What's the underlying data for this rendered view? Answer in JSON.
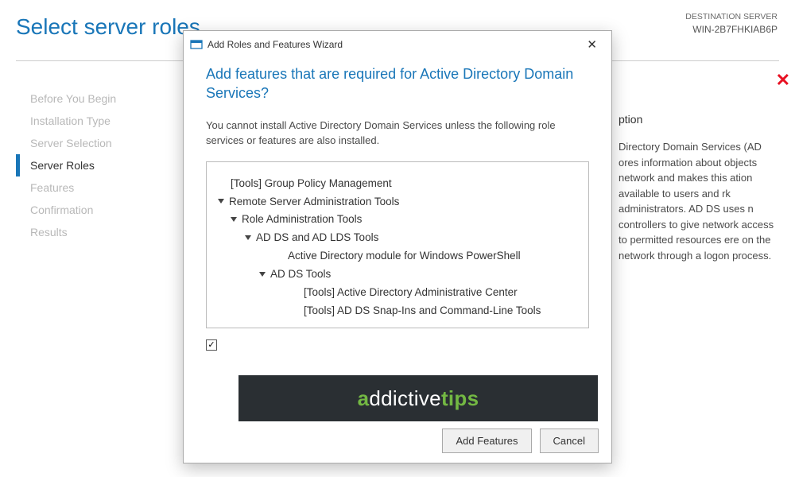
{
  "page_title": "Select server roles",
  "destination": {
    "label": "DESTINATION SERVER",
    "name": "WIN-2B7FHKIAB6P"
  },
  "sidebar": {
    "items": [
      {
        "label": "Before You Begin",
        "active": false
      },
      {
        "label": "Installation Type",
        "active": false
      },
      {
        "label": "Server Selection",
        "active": false
      },
      {
        "label": "Server Roles",
        "active": true
      },
      {
        "label": "Features",
        "active": false
      },
      {
        "label": "Confirmation",
        "active": false
      },
      {
        "label": "Results",
        "active": false
      }
    ]
  },
  "description": {
    "title_visible": "ption",
    "body_visible": "Directory Domain Services (AD ores information about objects network and makes this ation available to users and rk administrators. AD DS uses n controllers to give network access to permitted resources ere on the network through a logon process."
  },
  "dialog": {
    "title": "Add Roles and Features Wizard",
    "heading": "Add features that are required for Active Directory Domain Services?",
    "subtext": "You cannot install Active Directory Domain Services unless the following role services or features are also installed.",
    "tree": {
      "l1": "[Tools] Group Policy Management",
      "l2": "Remote Server Administration Tools",
      "l3": "Role Administration Tools",
      "l4": "AD DS and AD LDS Tools",
      "l5": "Active Directory module for Windows PowerShell",
      "l6": "AD DS Tools",
      "l7": "[Tools] Active Directory Administrative Center",
      "l8": "[Tools] AD DS Snap-Ins and Command-Line Tools"
    },
    "buttons": {
      "add": "Add Features",
      "cancel": "Cancel"
    }
  },
  "watermark": {
    "p1": "a",
    "p2": "ddictive",
    "p3": "tips"
  }
}
